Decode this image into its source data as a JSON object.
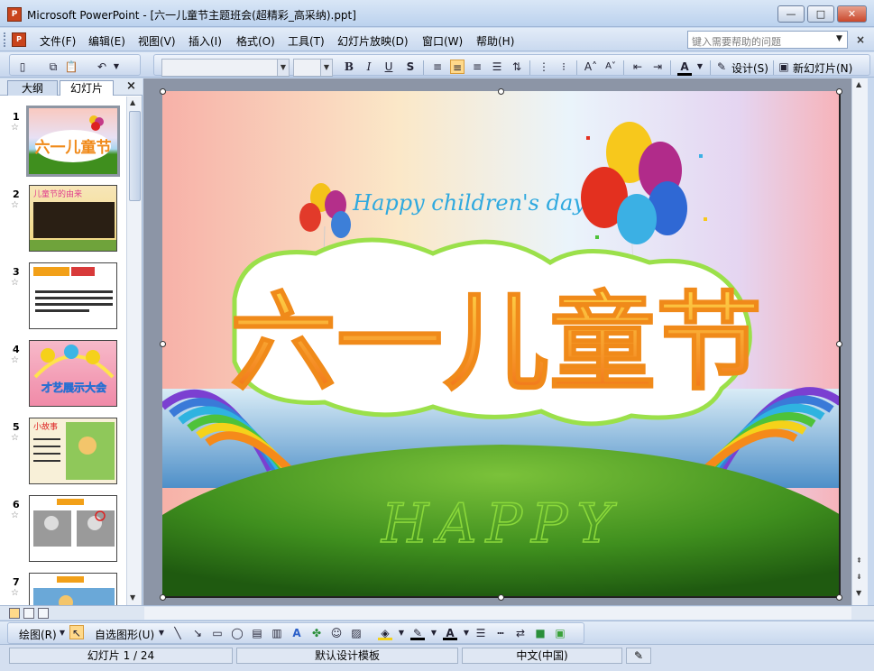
{
  "window": {
    "title": "Microsoft PowerPoint - [六一儿童节主题班会(超精彩_高采纳).ppt]",
    "app_icon_label": "P",
    "minimize_glyph": "—",
    "maximize_glyph": "□",
    "close_glyph": "✕"
  },
  "menu": {
    "items": [
      "文件(F)",
      "编辑(E)",
      "视图(V)",
      "插入(I)",
      "格式(O)",
      "工具(T)",
      "幻灯片放映(D)",
      "窗口(W)",
      "帮助(H)"
    ],
    "help_placeholder": "键入需要帮助的问题",
    "doc_close_glyph": "×"
  },
  "toolbar": {
    "bold": "B",
    "italic": "I",
    "underline": "U",
    "shadow": "S",
    "font_color_glyph": "A",
    "design_label": "设计(S)",
    "new_slide_label": "新幻灯片(N)"
  },
  "left_pane": {
    "tabs": [
      "大纲",
      "幻灯片"
    ],
    "active_tab": "幻灯片",
    "close_glyph": "×",
    "slides": [
      {
        "number": "1",
        "selected": true
      },
      {
        "number": "2",
        "selected": false
      },
      {
        "number": "3",
        "selected": false
      },
      {
        "number": "4",
        "selected": false
      },
      {
        "number": "5",
        "selected": false
      },
      {
        "number": "6",
        "selected": false
      },
      {
        "number": "7",
        "selected": false
      }
    ]
  },
  "slide": {
    "subtitle": "Happy children's day",
    "main_title": "六一儿童节",
    "happy_text": "HAPPY",
    "thumb2_title": "儿童节的由来",
    "thumb4_title": "才艺展示大会",
    "thumb5_title": "小故事"
  },
  "draw_toolbar": {
    "draw_label": "绘图(R)",
    "autoshapes_label": "自选图形(U)"
  },
  "status": {
    "slide_info": "幻灯片 1 / 24",
    "template": "默认设计模板",
    "language": "中文(中国)"
  },
  "colors": {
    "title_bar": "#c9d9ef",
    "slide_bg_sky": "#f6c4c4",
    "grass": "#3f8f1e"
  }
}
